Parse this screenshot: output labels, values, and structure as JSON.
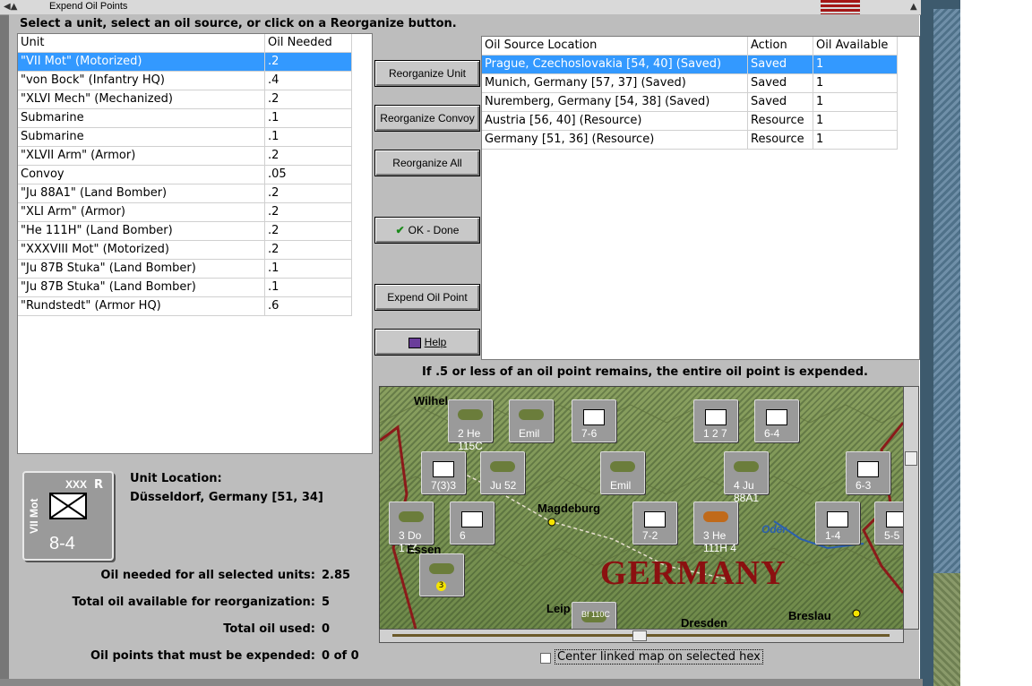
{
  "window": {
    "title": "Expend Oil Points"
  },
  "instruction": "Select a unit, select an oil source, or click on a Reorganize button.",
  "units_table": {
    "headers": [
      "Unit",
      "Oil Needed"
    ],
    "rows": [
      {
        "unit": "\"VII Mot\" (Motorized)",
        "oil": ".2",
        "selected": true
      },
      {
        "unit": "\"von Bock\" (Infantry HQ)",
        "oil": ".4"
      },
      {
        "unit": "\"XLVI Mech\" (Mechanized)",
        "oil": ".2"
      },
      {
        "unit": "Submarine",
        "oil": ".1"
      },
      {
        "unit": "Submarine",
        "oil": ".1"
      },
      {
        "unit": "\"XLVII Arm\" (Armor)",
        "oil": ".2"
      },
      {
        "unit": "Convoy",
        "oil": ".05"
      },
      {
        "unit": "\"Ju 88A1\" (Land Bomber)",
        "oil": ".2"
      },
      {
        "unit": "\"XLI Arm\" (Armor)",
        "oil": ".2"
      },
      {
        "unit": "\"He 111H\" (Land Bomber)",
        "oil": ".2"
      },
      {
        "unit": "\"XXXVIII Mot\" (Motorized)",
        "oil": ".2"
      },
      {
        "unit": "\"Ju 87B Stuka\" (Land Bomber)",
        "oil": ".1"
      },
      {
        "unit": "\"Ju 87B Stuka\" (Land Bomber)",
        "oil": ".1"
      },
      {
        "unit": "\"Rundstedt\" (Armor HQ)",
        "oil": ".6"
      }
    ]
  },
  "oil_table": {
    "headers": [
      "Oil Source Location",
      "Action",
      "Oil Available"
    ],
    "rows": [
      {
        "location": "Prague, Czechoslovakia [54, 40] (Saved)",
        "action": "Saved",
        "available": "1",
        "selected": true
      },
      {
        "location": "Munich, Germany [57, 37] (Saved)",
        "action": "Saved",
        "available": "1"
      },
      {
        "location": "Nuremberg, Germany [54, 38] (Saved)",
        "action": "Saved",
        "available": "1"
      },
      {
        "location": "Austria [56, 40] (Resource)",
        "action": "Resource",
        "available": "1"
      },
      {
        "location": "Germany [51, 36] (Resource)",
        "action": "Resource",
        "available": "1"
      }
    ]
  },
  "buttons": {
    "reorganize_unit": "Reorganize Unit",
    "reorganize_convoy": "Reorganize Convoy",
    "reorganize_all": "Reorganize All",
    "ok_done": "OK - Done",
    "expend_oil_point": "Expend Oil Point",
    "help": "Help"
  },
  "selected_unit": {
    "counter_name": "VII Mot",
    "counter_size": "XXX",
    "counter_flag": "R",
    "counter_strength": "8-4",
    "location_label": "Unit Location:",
    "location_value": "Düsseldorf, Germany [51, 34]"
  },
  "summary": {
    "needed_label": "Oil needed for all selected units:",
    "needed_value": "2.85",
    "available_label": "Total oil available for reorganization:",
    "available_value": "5",
    "used_label": "Total oil used:",
    "used_value": "0",
    "expended_label": "Oil points that must be expended:",
    "expended_value": "0 of 0"
  },
  "expend_note": "If .5 or less of an oil point remains, the entire oil point is expended.",
  "map": {
    "region_label": "GERMANY",
    "cities": [
      "Magdeburg",
      "Oder",
      "Breslau",
      "Dresden",
      "Leip",
      "Wilhel",
      "Essen"
    ],
    "counters": [
      {
        "label": "7-6"
      },
      {
        "label": "6-4"
      },
      {
        "label": "7(3)3"
      },
      {
        "label": "Ju 52"
      },
      {
        "label": "Emil"
      },
      {
        "label": "4 Ju 88A1"
      },
      {
        "label": "6-3"
      },
      {
        "label": "7-2"
      },
      {
        "label": "3 He 111H 4"
      },
      {
        "label": "1-4"
      },
      {
        "label": "5-5"
      },
      {
        "label": "3 Do 17Z"
      },
      {
        "label": "6"
      },
      {
        "label": "Bf 110C"
      },
      {
        "label": "2 He 115C"
      },
      {
        "label": "1 2 7"
      }
    ]
  },
  "center_map": {
    "label": "Center linked map on selected hex",
    "checked": false
  },
  "colors": {
    "selection": "#3399ff",
    "dialog_bg": "#bdbdbd",
    "germany_label": "#8b1010",
    "map_green": "#7f9656"
  }
}
